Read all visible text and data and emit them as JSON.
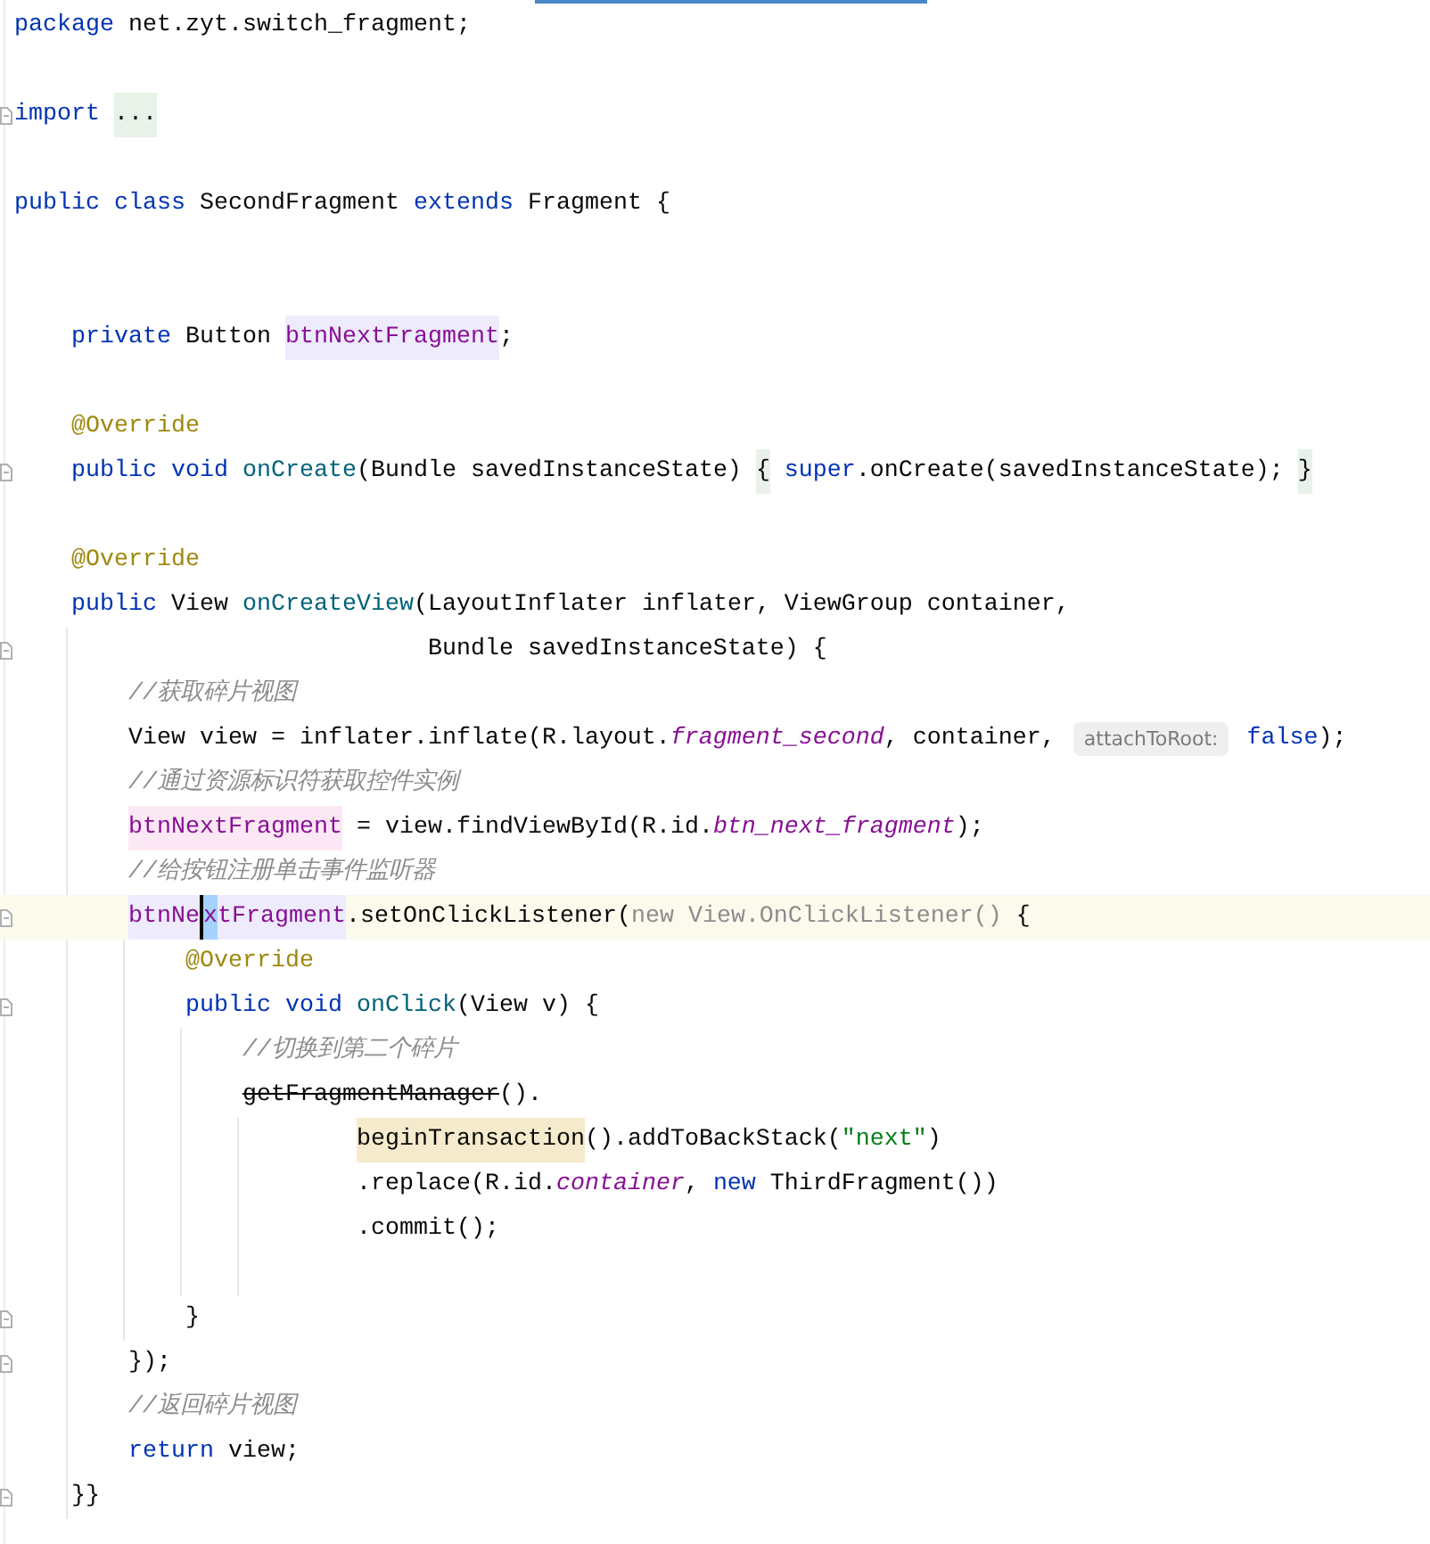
{
  "editor": {
    "lines": [
      {
        "kind": "code",
        "tokens": [
          {
            "text": "package",
            "kind": "keyword"
          },
          {
            "text": " net.zyt.switch_fragment;",
            "kind": "plain"
          }
        ]
      },
      {
        "kind": "blank"
      },
      {
        "kind": "code",
        "fold": true,
        "tokens": [
          {
            "text": "import ",
            "kind": "keyword"
          },
          {
            "text": "...",
            "kind": "plain",
            "folded": true
          }
        ]
      },
      {
        "kind": "blank"
      },
      {
        "kind": "code",
        "tokens": [
          {
            "text": "public class",
            "kind": "keyword"
          },
          {
            "text": " SecondFragment ",
            "kind": "plain"
          },
          {
            "text": "extends",
            "kind": "keyword"
          },
          {
            "text": " Fragment {",
            "kind": "plain"
          }
        ]
      },
      {
        "kind": "blank"
      },
      {
        "kind": "blank"
      },
      {
        "kind": "code",
        "tokens": [
          {
            "text": "    private",
            "kind": "keyword"
          },
          {
            "text": " Button ",
            "kind": "plain"
          },
          {
            "text": "btnNextFragment",
            "kind": "field",
            "usage": true
          },
          {
            "text": ";",
            "kind": "plain"
          }
        ]
      },
      {
        "kind": "blank"
      },
      {
        "kind": "code",
        "tokens": [
          {
            "text": "    @Override",
            "kind": "annotation"
          }
        ]
      },
      {
        "kind": "code",
        "fold": true,
        "tokens": [
          {
            "text": "    public void ",
            "kind": "keyword"
          },
          {
            "text": "onCreate",
            "kind": "method"
          },
          {
            "text": "(Bundle savedInstanceState) ",
            "kind": "plain"
          },
          {
            "text": "{",
            "kind": "plain",
            "folded": true
          },
          {
            "text": " super",
            "kind": "keyword"
          },
          {
            "text": ".onCreate(savedInstanceState); ",
            "kind": "plain"
          },
          {
            "text": "}",
            "kind": "plain",
            "folded": true
          }
        ]
      },
      {
        "kind": "blank"
      },
      {
        "kind": "code",
        "tokens": [
          {
            "text": "    @Override",
            "kind": "annotation"
          }
        ]
      },
      {
        "kind": "code",
        "tokens": [
          {
            "text": "    public",
            "kind": "keyword"
          },
          {
            "text": " View ",
            "kind": "plain"
          },
          {
            "text": "onCreateView",
            "kind": "method"
          },
          {
            "text": "(LayoutInflater inflater, ViewGroup container,",
            "kind": "plain"
          }
        ]
      },
      {
        "kind": "code",
        "fold": true,
        "tokens": [
          {
            "text": "                             Bundle savedInstanceState) {",
            "kind": "plain"
          }
        ]
      },
      {
        "kind": "code",
        "tokens": [
          {
            "text": "        //获取碎片视图",
            "kind": "comment"
          }
        ]
      },
      {
        "kind": "code",
        "tokens": [
          {
            "text": "        View view = inflater.inflate(R.layout.",
            "kind": "plain"
          },
          {
            "text": "fragment_second",
            "kind": "field_italic"
          },
          {
            "text": ", container, ",
            "kind": "plain"
          },
          {
            "text": "attachToRoot:",
            "kind": "hint"
          },
          {
            "text": " false",
            "kind": "keyword"
          },
          {
            "text": ");",
            "kind": "plain"
          }
        ]
      },
      {
        "kind": "code",
        "tokens": [
          {
            "text": "        //通过资源标识符获取控件实例",
            "kind": "comment"
          }
        ]
      },
      {
        "kind": "code",
        "tokens": [
          {
            "text": "        btnNextFragment",
            "kind": "field",
            "write_access": true
          },
          {
            "text": " = view.findViewById(R.id.",
            "kind": "plain"
          },
          {
            "text": "btn_next_fragment",
            "kind": "field_italic"
          },
          {
            "text": ");",
            "kind": "plain"
          }
        ]
      },
      {
        "kind": "code",
        "tokens": [
          {
            "text": "        //给按钮注册单击事件监听器",
            "kind": "comment"
          }
        ]
      },
      {
        "kind": "code",
        "current": true,
        "fold": true,
        "tokens": [
          {
            "text": "        btnNe",
            "kind": "field",
            "usage": true
          },
          {
            "text": "x",
            "kind": "field",
            "usage": true,
            "caret": true
          },
          {
            "text": "tFragment",
            "kind": "field",
            "usage": true
          },
          {
            "text": ".setOnClickListener(",
            "kind": "plain"
          },
          {
            "text": "new View.OnClickListener()",
            "kind": "dim"
          },
          {
            "text": " {",
            "kind": "plain"
          }
        ]
      },
      {
        "kind": "code",
        "tokens": [
          {
            "text": "            @Override",
            "kind": "annotation"
          }
        ]
      },
      {
        "kind": "code",
        "fold": true,
        "tokens": [
          {
            "text": "            public void ",
            "kind": "keyword"
          },
          {
            "text": "onClick",
            "kind": "method"
          },
          {
            "text": "(View v) {",
            "kind": "plain"
          }
        ]
      },
      {
        "kind": "code",
        "tokens": [
          {
            "text": "                //切换到第二个碎片",
            "kind": "comment"
          }
        ]
      },
      {
        "kind": "code",
        "tokens": [
          {
            "text": "                getFragmentManager",
            "kind": "deprecated"
          },
          {
            "text": "().",
            "kind": "plain"
          }
        ]
      },
      {
        "kind": "code",
        "tokens": [
          {
            "text": "                        beginTransaction",
            "kind": "plain",
            "search_match": true
          },
          {
            "text": "().addToBackStack(",
            "kind": "plain"
          },
          {
            "text": "\"next\"",
            "kind": "string"
          },
          {
            "text": ")",
            "kind": "plain"
          }
        ]
      },
      {
        "kind": "code",
        "tokens": [
          {
            "text": "                        .replace(R.id.",
            "kind": "plain"
          },
          {
            "text": "container",
            "kind": "field_italic"
          },
          {
            "text": ", ",
            "kind": "plain"
          },
          {
            "text": "new",
            "kind": "keyword"
          },
          {
            "text": " ThirdFragment())",
            "kind": "plain"
          }
        ]
      },
      {
        "kind": "code",
        "tokens": [
          {
            "text": "                        .commit();",
            "kind": "plain"
          }
        ]
      },
      {
        "kind": "blank"
      },
      {
        "kind": "code",
        "fold": true,
        "tokens": [
          {
            "text": "            }",
            "kind": "plain"
          }
        ]
      },
      {
        "kind": "code",
        "fold": true,
        "tokens": [
          {
            "text": "        });",
            "kind": "plain"
          }
        ]
      },
      {
        "kind": "code",
        "tokens": [
          {
            "text": "        //返回碎片视图",
            "kind": "comment"
          }
        ]
      },
      {
        "kind": "code",
        "tokens": [
          {
            "text": "        return",
            "kind": "keyword"
          },
          {
            "text": " view;",
            "kind": "plain"
          }
        ]
      },
      {
        "kind": "code",
        "fold": true,
        "tokens": [
          {
            "text": "    }}",
            "kind": "plain"
          }
        ]
      }
    ]
  }
}
